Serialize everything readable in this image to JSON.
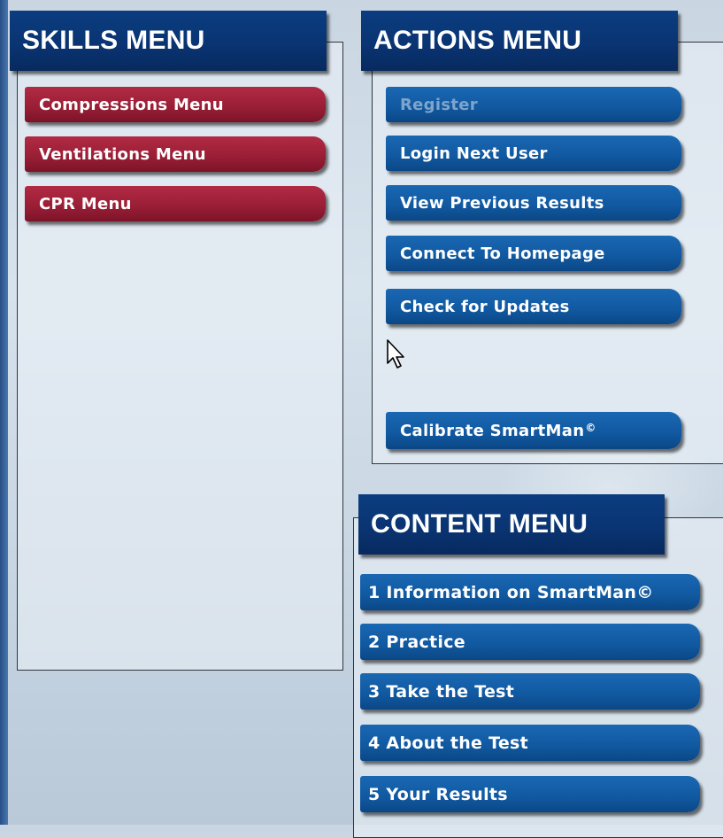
{
  "skills_menu": {
    "title": "SKILLS MENU",
    "buttons": [
      "Compressions Menu",
      "Ventilations Menu",
      "CPR Menu"
    ]
  },
  "actions_menu": {
    "title": "ACTIONS MENU",
    "buttons": [
      {
        "label": "Register",
        "enabled": false
      },
      {
        "label": "Login Next User",
        "enabled": true
      },
      {
        "label": "View Previous Results",
        "enabled": true
      },
      {
        "label": "Connect To Homepage",
        "enabled": true
      },
      {
        "label": "Check for Updates",
        "enabled": true
      }
    ],
    "calibrate": {
      "label": "Calibrate SmartMan",
      "sup": "©"
    }
  },
  "content_menu": {
    "title": "CONTENT MENU",
    "buttons": [
      "1 Information on SmartMan©",
      "2 Practice",
      "3 Take the Test",
      "4 About the Test",
      "5 Your Results"
    ]
  },
  "colors": {
    "header_blue": "#0a3473",
    "skills_red": "#9a1f36",
    "action_blue": "#115aa2",
    "disabled_text": "#7fa4cc"
  }
}
